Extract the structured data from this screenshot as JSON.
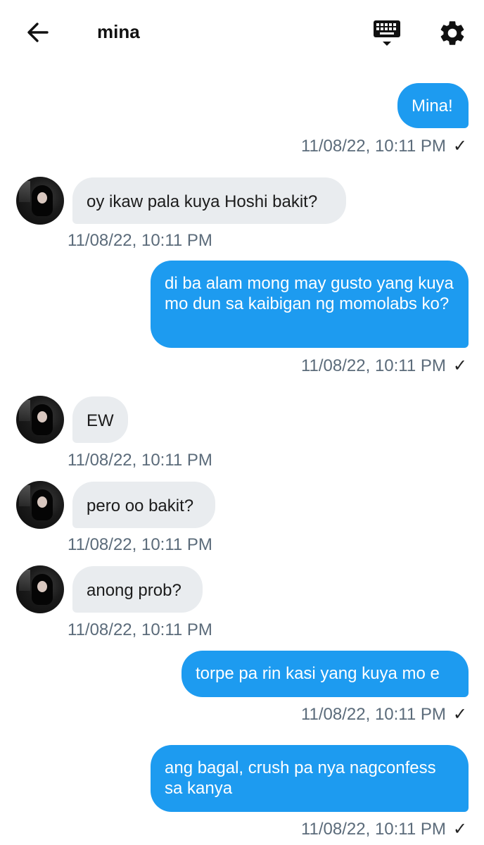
{
  "header": {
    "title": "mina"
  },
  "messages": [
    {
      "dir": "out",
      "text": "Mina!",
      "time": "11/08/22, 10:11 PM"
    },
    {
      "dir": "in",
      "text": "oy ikaw pala kuya Hoshi bakit?",
      "time": "11/08/22, 10:11 PM"
    },
    {
      "dir": "out",
      "text": "di ba alam mong may gusto yang kuya mo dun sa kaibigan ng momolabs ko?",
      "time": "11/08/22, 10:11 PM"
    },
    {
      "dir": "in",
      "text": "EW",
      "time": "11/08/22, 10:11 PM"
    },
    {
      "dir": "in",
      "text": "pero oo bakit?",
      "time": "11/08/22, 10:11 PM"
    },
    {
      "dir": "in",
      "text": "anong prob?",
      "time": "11/08/22, 10:11 PM"
    },
    {
      "dir": "out",
      "text": "torpe pa rin kasi yang kuya mo e",
      "time": "11/08/22, 10:11 PM"
    },
    {
      "dir": "out",
      "text": "ang bagal, crush pa nya nagconfess sa kanya",
      "time": "11/08/22, 10:11 PM"
    }
  ],
  "colors": {
    "outgoing_bubble": "#1d9bf0",
    "incoming_bubble": "#e9ecef",
    "timestamp": "#5b6b7a"
  },
  "icons": {
    "back": "arrow-left-icon",
    "keyboard": "keyboard-icon",
    "settings": "gear-icon",
    "sent": "checkmark-icon"
  }
}
